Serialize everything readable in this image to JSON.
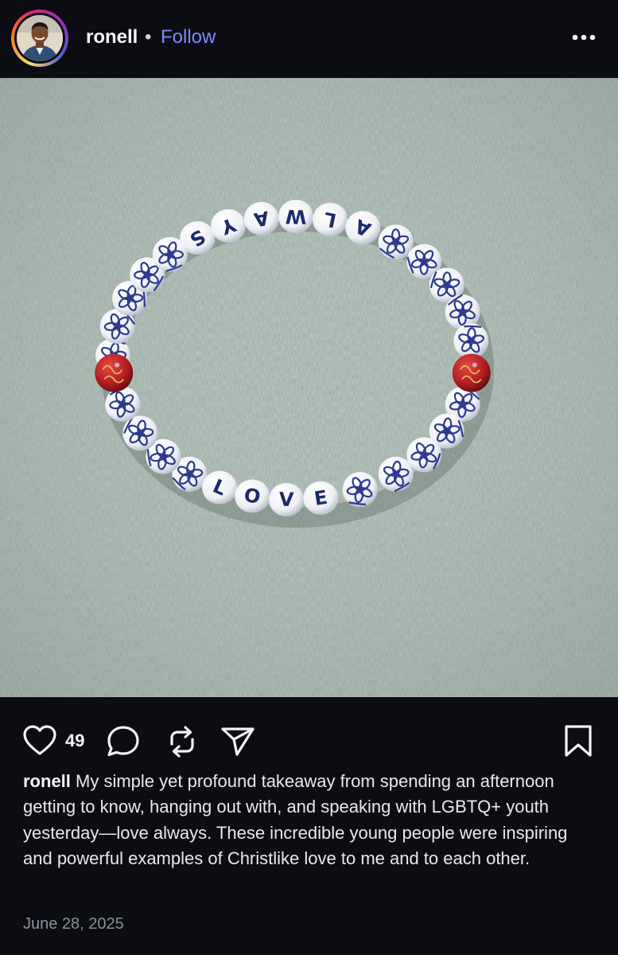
{
  "header": {
    "username": "ronell",
    "separator": "•",
    "follow_label": "Follow",
    "more_icon": "more-horizontal-icon"
  },
  "photo": {
    "bracelet_top_word": [
      "S",
      "Y",
      "A",
      "W",
      "L",
      "A"
    ],
    "bracelet_bottom_word": [
      "L",
      "O",
      "V",
      "E"
    ],
    "background_color": "#9aaca3",
    "bead_blue": "#2c3a8f",
    "bead_red": "#b51e22"
  },
  "actions": {
    "like_icon": "heart-icon",
    "like_count": "49",
    "comment_icon": "comment-icon",
    "repost_icon": "repost-icon",
    "share_icon": "send-icon",
    "save_icon": "bookmark-icon"
  },
  "caption": {
    "username": "ronell",
    "text": "My simple yet profound takeaway from spending an afternoon getting to know, hanging out with, and speaking with LGBTQ+ youth yesterday—love always. These incredible young people were inspiring and powerful examples of Christlike love to me and to each other."
  },
  "date": "June 28, 2025"
}
